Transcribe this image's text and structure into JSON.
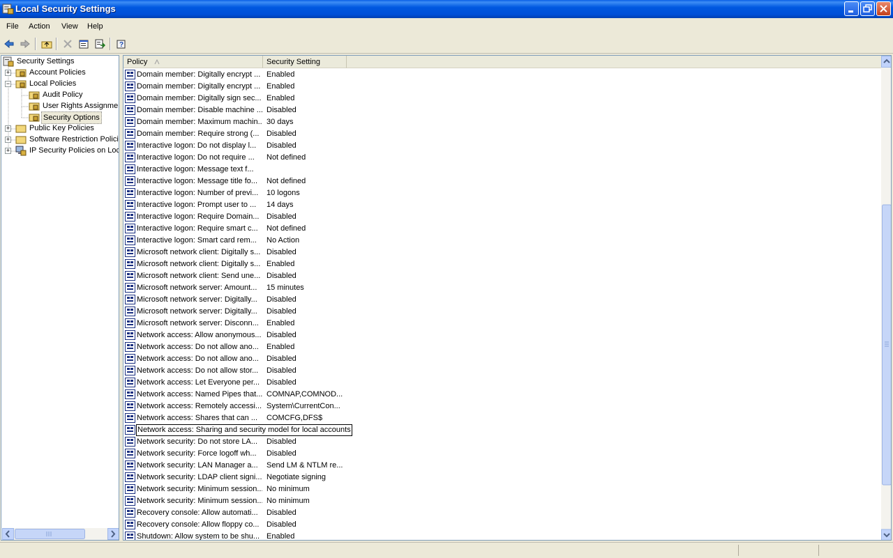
{
  "window": {
    "title": "Local Security Settings"
  },
  "menu": [
    "File",
    "Action",
    "View",
    "Help"
  ],
  "toolbar_icons": [
    "back-icon",
    "forward-icon",
    "up-folder-icon",
    "delete-icon",
    "properties-icon",
    "export-list-icon",
    "help-icon"
  ],
  "tree": [
    {
      "label": "Security Settings",
      "level": 0,
      "icon": "security-settings-icon",
      "expander": ""
    },
    {
      "label": "Account Policies",
      "level": 1,
      "icon": "folder-lock-icon",
      "expander": "+"
    },
    {
      "label": "Local Policies",
      "level": 1,
      "icon": "folder-lock-icon",
      "expander": "-"
    },
    {
      "label": "Audit Policy",
      "level": 2,
      "icon": "folder-lock-icon",
      "expander": ""
    },
    {
      "label": "User Rights Assignmen",
      "level": 2,
      "icon": "folder-lock-icon",
      "expander": ""
    },
    {
      "label": "Security Options",
      "level": 2,
      "icon": "folder-lock-icon",
      "expander": "",
      "selected": true
    },
    {
      "label": "Public Key Policies",
      "level": 1,
      "icon": "folder-icon",
      "expander": "+"
    },
    {
      "label": "Software Restriction Policie",
      "level": 1,
      "icon": "folder-icon",
      "expander": "+"
    },
    {
      "label": "IP Security Policies on Loca",
      "level": 1,
      "icon": "ip-security-icon",
      "expander": "+"
    }
  ],
  "columns": {
    "policy": "Policy",
    "setting": "Security Setting"
  },
  "rows": [
    {
      "policy": "Domain member: Digitally encrypt ...",
      "setting": "Enabled"
    },
    {
      "policy": "Domain member: Digitally encrypt ...",
      "setting": "Enabled"
    },
    {
      "policy": "Domain member: Digitally sign sec...",
      "setting": "Enabled"
    },
    {
      "policy": "Domain member: Disable machine ...",
      "setting": "Disabled"
    },
    {
      "policy": "Domain member: Maximum machin...",
      "setting": "30 days"
    },
    {
      "policy": "Domain member: Require strong (...",
      "setting": "Disabled"
    },
    {
      "policy": "Interactive logon: Do not display l...",
      "setting": "Disabled"
    },
    {
      "policy": "Interactive logon: Do not require ...",
      "setting": "Not defined"
    },
    {
      "policy": "Interactive logon: Message text f...",
      "setting": ""
    },
    {
      "policy": "Interactive logon: Message title fo...",
      "setting": "Not defined"
    },
    {
      "policy": "Interactive logon: Number of previ...",
      "setting": "10 logons"
    },
    {
      "policy": "Interactive logon: Prompt user to ...",
      "setting": "14 days"
    },
    {
      "policy": "Interactive logon: Require Domain...",
      "setting": "Disabled"
    },
    {
      "policy": "Interactive logon: Require smart c...",
      "setting": "Not defined"
    },
    {
      "policy": "Interactive logon: Smart card rem...",
      "setting": "No Action"
    },
    {
      "policy": "Microsoft network client: Digitally s...",
      "setting": "Disabled"
    },
    {
      "policy": "Microsoft network client: Digitally s...",
      "setting": "Enabled"
    },
    {
      "policy": "Microsoft network client: Send une...",
      "setting": "Disabled"
    },
    {
      "policy": "Microsoft network server: Amount...",
      "setting": "15 minutes"
    },
    {
      "policy": "Microsoft network server: Digitally...",
      "setting": "Disabled"
    },
    {
      "policy": "Microsoft network server: Digitally...",
      "setting": "Disabled"
    },
    {
      "policy": "Microsoft network server: Disconn...",
      "setting": "Enabled"
    },
    {
      "policy": "Network access: Allow anonymous...",
      "setting": "Disabled"
    },
    {
      "policy": "Network access: Do not allow ano...",
      "setting": "Enabled"
    },
    {
      "policy": "Network access: Do not allow ano...",
      "setting": "Disabled"
    },
    {
      "policy": "Network access: Do not allow stor...",
      "setting": "Disabled"
    },
    {
      "policy": "Network access: Let Everyone per...",
      "setting": "Disabled"
    },
    {
      "policy": "Network access: Named Pipes that...",
      "setting": "COMNAP,COMNOD..."
    },
    {
      "policy": "Network access: Remotely accessi...",
      "setting": "System\\CurrentCon..."
    },
    {
      "policy": "Network access: Shares that can ...",
      "setting": "COMCFG,DFS$"
    },
    {
      "policy": "Network access: Sharing and security model for local accounts",
      "setting": "",
      "focused": true
    },
    {
      "policy": "Network security: Do not store LA...",
      "setting": "Disabled"
    },
    {
      "policy": "Network security: Force logoff wh...",
      "setting": "Disabled"
    },
    {
      "policy": "Network security: LAN Manager a...",
      "setting": "Send LM & NTLM re..."
    },
    {
      "policy": "Network security: LDAP client signi...",
      "setting": "Negotiate signing"
    },
    {
      "policy": "Network security: Minimum session...",
      "setting": "No minimum"
    },
    {
      "policy": "Network security: Minimum session...",
      "setting": "No minimum"
    },
    {
      "policy": "Recovery console: Allow automati...",
      "setting": "Disabled"
    },
    {
      "policy": "Recovery console: Allow floppy co...",
      "setting": "Disabled"
    },
    {
      "policy": "Shutdown: Allow system to be shu...",
      "setting": "Enabled"
    }
  ]
}
